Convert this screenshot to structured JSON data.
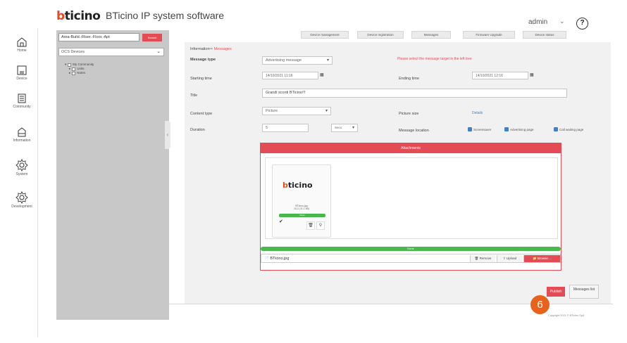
{
  "app": {
    "brand": "bticino",
    "brand_first": "b",
    "brand_rest": "ticino",
    "title": "BTicino IP system software",
    "user": "admin",
    "help": "?"
  },
  "sidebar": {
    "items": [
      {
        "label": "Home",
        "icon": "home-icon"
      },
      {
        "label": "Device",
        "icon": "device-icon"
      },
      {
        "label": "Community",
        "icon": "community-icon"
      },
      {
        "label": "Information",
        "icon": "information-icon"
      },
      {
        "label": "System",
        "icon": "gear-icon"
      },
      {
        "label": "Development",
        "icon": "gear-icon"
      }
    ]
  },
  "tree_panel": {
    "address_placeholder": "Area-Build.-Riser.-Floor.-Apt",
    "search_label": "Search",
    "devices_select": "OCS Devices",
    "tree": [
      "My Community",
      "Units",
      "Notes"
    ]
  },
  "toolbar": {
    "buttons": [
      "Device management",
      "Device registration",
      "Messages",
      "Firmware Upgrade",
      "Device status"
    ]
  },
  "form": {
    "breadcrumb_root": "Information",
    "breadcrumb_current": "Messages",
    "message_type_label": "Message type",
    "message_type_value": "Advertising message",
    "hint": "Please select the message target in the left tree",
    "starting_time_label": "Starting time",
    "starting_time_value": "14/10/2021 11:16",
    "ending_time_label": "Ending time",
    "ending_time_value": "14/10/2021 12:16",
    "title_label": "Title",
    "title_value": "Grandi sconti BTicino!!!",
    "content_type_label": "Content type",
    "content_type_value": "Picture",
    "picture_size_label": "Picture size",
    "picture_size_link": "Details",
    "duration_label": "Duration",
    "duration_value": "5",
    "duration_unit": "Seco",
    "message_location_label": "Message location",
    "locations": [
      "Screensaver",
      "Advertising page",
      "Call waiting page"
    ]
  },
  "attachments": {
    "header": "Attachments",
    "thumb_brand_first": "b",
    "thumb_brand_rest": "ticino",
    "thumb_file": "BTicino.jpg",
    "thumb_size": "1111 (11.1 kB)",
    "thumb_status": "Done",
    "progress_label": "Done",
    "progress": 1.0,
    "file_name": "BTicino.jpg",
    "remove_label": "Remove",
    "upload_label": "Upload",
    "browse_label": "Browse ..."
  },
  "actions": {
    "publish": "Publish",
    "messages_list": "Messages list"
  },
  "step_badge": "6",
  "footer": {
    "copyright": "Copyright 2021 © BTicino SpA"
  },
  "colors": {
    "accent_red": "#e34b55",
    "brand_orange": "#e84a1f",
    "badge_orange": "#e8621e",
    "success_green": "#47b84b",
    "check_blue": "#3f7fd0"
  }
}
